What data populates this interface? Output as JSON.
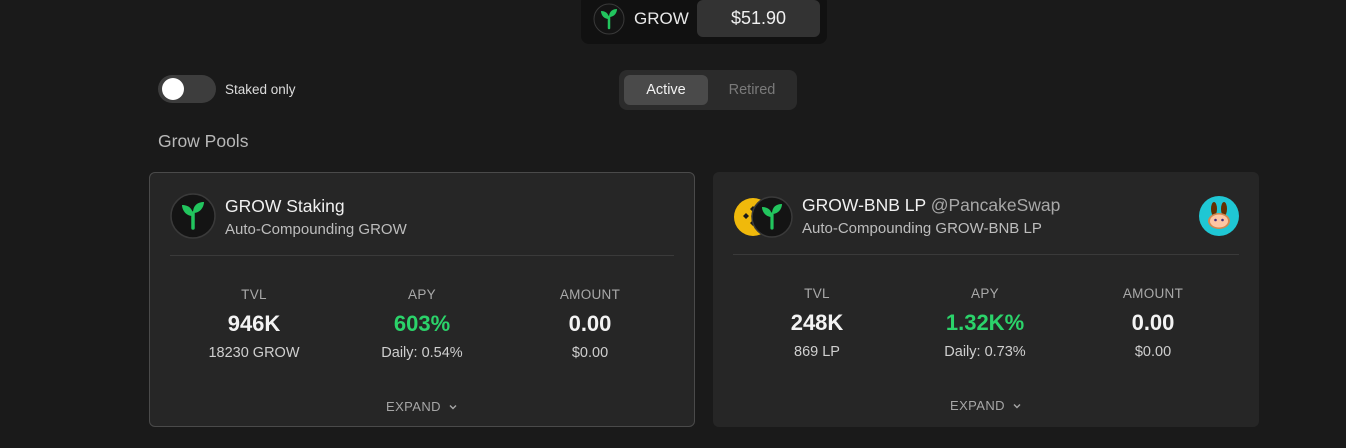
{
  "header": {
    "token": "GROW",
    "price": "$51.90"
  },
  "filters": {
    "staked_only_label": "Staked only",
    "staked_only_on": false,
    "tabs": [
      {
        "label": "Active",
        "active": true
      },
      {
        "label": "Retired",
        "active": false
      }
    ]
  },
  "section_title": "Grow Pools",
  "pools": [
    {
      "title": "GROW Staking",
      "partner": "",
      "subtitle": "Auto-Compounding GROW",
      "tvl": {
        "label": "TVL",
        "value": "946K",
        "sub": "18230 GROW"
      },
      "apy": {
        "label": "APY",
        "value": "603%",
        "sub": "Daily: 0.54%"
      },
      "amount": {
        "label": "AMOUNT",
        "value": "0.00",
        "sub": "$0.00"
      },
      "expand_label": "EXPAND"
    },
    {
      "title": "GROW-BNB LP",
      "partner": "@PancakeSwap",
      "subtitle": "Auto-Compounding GROW-BNB LP",
      "tvl": {
        "label": "TVL",
        "value": "248K",
        "sub": "869 LP"
      },
      "apy": {
        "label": "APY",
        "value": "1.32K%",
        "sub": "Daily: 0.73%"
      },
      "amount": {
        "label": "AMOUNT",
        "value": "0.00",
        "sub": "$0.00"
      },
      "expand_label": "EXPAND"
    }
  ],
  "icons": {
    "grow_logo": "sprout-icon",
    "bnb_logo": "bnb-icon",
    "pancake_logo": "pancake-bunny-icon",
    "expand": "chevron-down-icon"
  },
  "colors": {
    "apy_green": "#2bd36a",
    "bnb_yellow": "#f0b90b",
    "grow_green": "#22c55e",
    "pancake_teal": "#1fc7d4"
  }
}
